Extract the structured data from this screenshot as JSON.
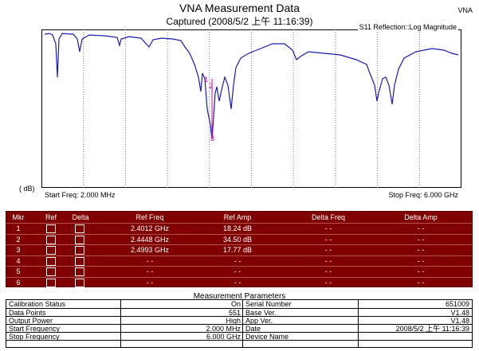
{
  "header": {
    "title": "VNA Measurement Data",
    "subtitle": "Captured  (2008/5/2 上午 11:16:39)",
    "brand": "VNA"
  },
  "plot": {
    "mode": "S11 Reflection::Log Magnitude",
    "ylabel": "( dB)",
    "start_freq": "Start Freq: 2.000 MHz",
    "stop_freq": "Stop Freq: 6.000 GHz",
    "trace_color": "#1a1ab5",
    "marker_color": "#e000c0",
    "markers": [
      "1",
      "2",
      "3"
    ]
  },
  "marker_table": {
    "headers": [
      "Mkr",
      "Ref",
      "Delta",
      "Ref Freq",
      "Ref Amp",
      "Delta Freq",
      "Delta Amp"
    ],
    "rows": [
      {
        "mkr": "1",
        "ref_freq": "2.4012 GHz",
        "ref_amp": "18.24 dB",
        "delta_freq": "- -",
        "delta_amp": "- -"
      },
      {
        "mkr": "2",
        "ref_freq": "2.4448 GHz",
        "ref_amp": "34.50 dB",
        "delta_freq": "- -",
        "delta_amp": "- -"
      },
      {
        "mkr": "3",
        "ref_freq": "2.4993 GHz",
        "ref_amp": "17.77 dB",
        "delta_freq": "- -",
        "delta_amp": "- -"
      },
      {
        "mkr": "4",
        "ref_freq": "- -",
        "ref_amp": "- -",
        "delta_freq": "- -",
        "delta_amp": "- -"
      },
      {
        "mkr": "5",
        "ref_freq": "- -",
        "ref_amp": "- -",
        "delta_freq": "- -",
        "delta_amp": "- -"
      },
      {
        "mkr": "6",
        "ref_freq": "- -",
        "ref_amp": "- -",
        "delta_freq": "- -",
        "delta_amp": "- -"
      }
    ],
    "bg_color": "#800000"
  },
  "params": {
    "title": "Measurement Parameters",
    "rows": [
      {
        "label": "Calibration Status",
        "value": "On",
        "label2": "Serial Number",
        "value2": "651009"
      },
      {
        "label": "Data Points",
        "value": "551",
        "label2": "Base Ver.",
        "value2": "V1.48"
      },
      {
        "label": "Output Power",
        "value": "High",
        "label2": "App Ver.",
        "value2": "V1.48"
      },
      {
        "label": "Start Frequency",
        "value": "2.000 MHz",
        "label2": "Date",
        "value2": "2008/5/2 上午 11:16:39"
      },
      {
        "label": "Stop Frequency",
        "value": "6.000 GHz",
        "label2": "Device Name",
        "value2": ""
      },
      {
        "label": "",
        "value": "",
        "label2": "",
        "value2": ""
      }
    ]
  }
}
